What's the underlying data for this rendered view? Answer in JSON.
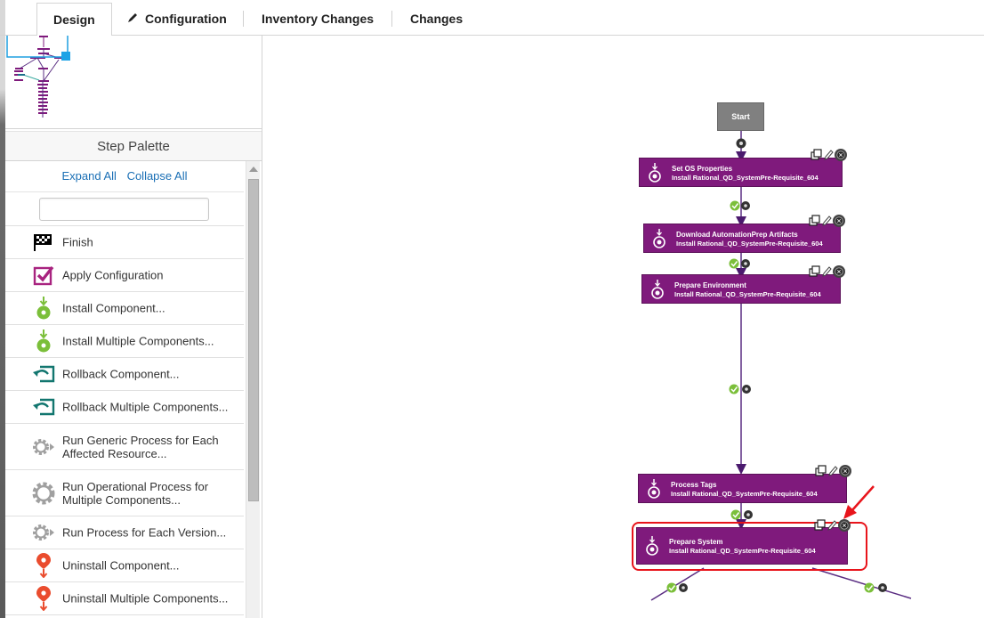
{
  "tabs": [
    {
      "label": "Design",
      "active": true
    },
    {
      "label": "Configuration",
      "icon": "pencil-icon"
    },
    {
      "label": "Inventory Changes"
    },
    {
      "label": "Changes"
    }
  ],
  "palette": {
    "title": "Step Palette",
    "expand_all": "Expand All",
    "collapse_all": "Collapse All",
    "search": {
      "value": "",
      "placeholder": ""
    },
    "items": [
      {
        "label": "Finish",
        "icon": "checkered-flag-icon"
      },
      {
        "label": "Apply Configuration",
        "icon": "checkbox-icon"
      },
      {
        "label": "Install Component...",
        "icon": "install-icon"
      },
      {
        "label": "Install Multiple Components...",
        "icon": "install-icon"
      },
      {
        "label": "Rollback Component...",
        "icon": "rollback-icon"
      },
      {
        "label": "Rollback Multiple Components...",
        "icon": "rollback-icon"
      },
      {
        "label": "Run Generic Process for Each Affected Resource...",
        "icon": "gear-arrow-icon"
      },
      {
        "label": "Run Operational Process for Multiple Components...",
        "icon": "gear-icon"
      },
      {
        "label": "Run Process for Each Version...",
        "icon": "gear-arrow-icon"
      },
      {
        "label": "Uninstall Component...",
        "icon": "uninstall-icon"
      },
      {
        "label": "Uninstall Multiple Components...",
        "icon": "uninstall-icon"
      }
    ]
  },
  "workflow": {
    "start_label": "Start",
    "steps": [
      {
        "name": "Set OS Properties",
        "sub": "Install Rational_QD_SystemPre-Requisite_604"
      },
      {
        "name": "Download AutomationPrep Artifacts",
        "sub": "Install Rational_QD_SystemPre-Requisite_604"
      },
      {
        "name": "Prepare Environment",
        "sub": "Install Rational_QD_SystemPre-Requisite_604"
      },
      {
        "name": "Process Tags",
        "sub": "Install Rational_QD_SystemPre-Requisite_604"
      },
      {
        "name": "Prepare System",
        "sub": "Install Rational_QD_SystemPre-Requisite_604",
        "highlighted": true
      }
    ]
  },
  "colors": {
    "step_fill": "#7f1a7c",
    "connector": "#5a2d82",
    "success": "#7bbf3a",
    "highlight": "#e8141b",
    "link": "#1a6fb5"
  }
}
